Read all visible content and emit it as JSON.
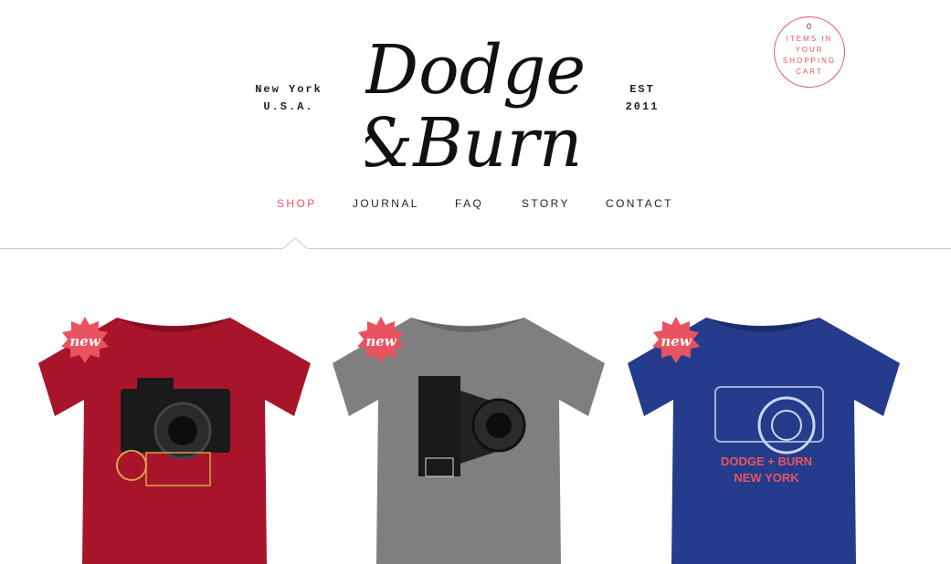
{
  "brand": {
    "logo_line1": "Dodge",
    "logo_line2": "&Burn",
    "location": [
      "New York",
      "U.S.A."
    ],
    "established": [
      "EST",
      "2011"
    ]
  },
  "cart": {
    "count": "0",
    "label": "ITEMS IN YOUR SHOPPING CART",
    "accent": "#e9535f"
  },
  "nav": {
    "items": [
      {
        "label": "SHOP",
        "active": true
      },
      {
        "label": "JOURNAL",
        "active": false
      },
      {
        "label": "FAQ",
        "active": false
      },
      {
        "label": "STORY",
        "active": false
      },
      {
        "label": "CONTACT",
        "active": false
      }
    ]
  },
  "products": [
    {
      "badge": "new",
      "shirt_color": "#a8152b",
      "print_text": ""
    },
    {
      "badge": "new",
      "shirt_color": "#7f7f7f",
      "print_text": ""
    },
    {
      "badge": "new",
      "shirt_color": "#253c8c",
      "print_text": [
        "DODGE + BURN",
        "NEW YORK"
      ]
    }
  ],
  "colors": {
    "accent": "#e9535f",
    "divider": "#b9d1e0",
    "text": "#222222"
  }
}
